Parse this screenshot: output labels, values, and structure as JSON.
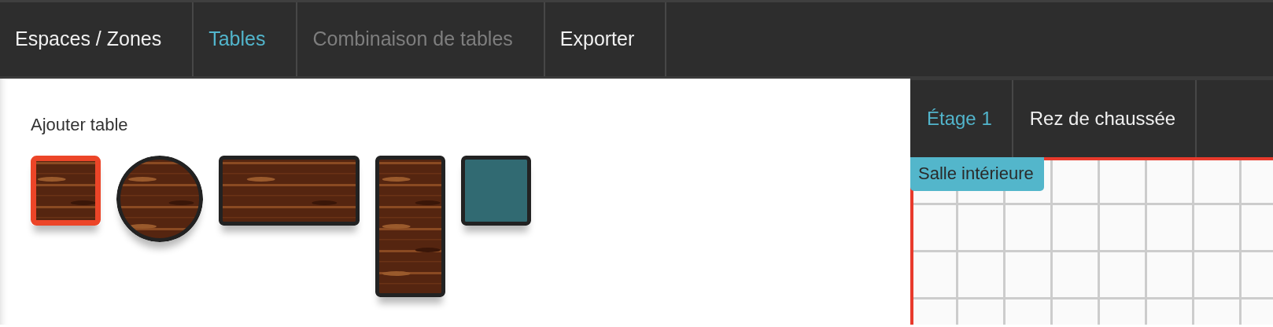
{
  "tabs": [
    {
      "label": "Espaces / Zones",
      "selected": false,
      "disabled": false
    },
    {
      "label": "Tables",
      "selected": true,
      "disabled": false
    },
    {
      "label": "Combinaison de tables",
      "selected": false,
      "disabled": true
    },
    {
      "label": "Exporter",
      "selected": false,
      "disabled": false
    }
  ],
  "add_table": {
    "title": "Ajouter table",
    "tables": [
      {
        "kind": "wood-square",
        "selected": true
      },
      {
        "kind": "wood-round",
        "selected": false
      },
      {
        "kind": "wood-wide",
        "selected": false
      },
      {
        "kind": "wood-tall",
        "selected": false
      },
      {
        "kind": "plain-square",
        "color": "#316a72",
        "selected": false
      }
    ]
  },
  "floors": [
    {
      "label": "Étage 1",
      "selected": true
    },
    {
      "label": "Rez de chaussée",
      "selected": false
    }
  ],
  "room": {
    "label": "Salle intérieure"
  }
}
